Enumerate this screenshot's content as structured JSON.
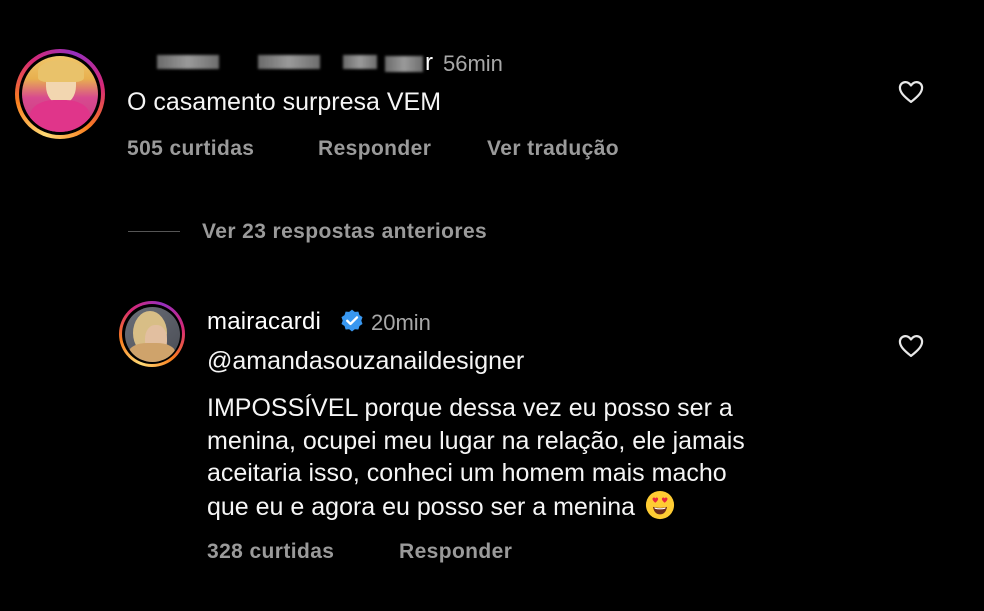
{
  "comment1": {
    "username_tail": "r",
    "time": "56min",
    "text": "O casamento surpresa VEM",
    "likes": "505 curtidas",
    "reply_label": "Responder",
    "translate_label": "Ver tradução"
  },
  "thread": {
    "view_replies_label": "Ver 23 respostas anteriores"
  },
  "reply": {
    "username": "mairacardi",
    "verified_icon": "verified-badge-icon",
    "time": "20min",
    "mention": "@amandasouzanaildesigner",
    "lines": [
      "IMPOSSÍVEL porque dessa vez eu posso ser a",
      "menina, ocupei meu lugar na relação, ele jamais",
      "aceitaria isso, conheci um homem mais macho",
      "que eu e agora eu posso ser a menina"
    ],
    "emoji": "heart-eyes-emoji",
    "likes": "328 curtidas",
    "reply_label": "Responder"
  },
  "colors": {
    "background": "#000000",
    "text": "#f5f5f5",
    "muted": "#9a9a9a",
    "verified": "#3897f0"
  }
}
